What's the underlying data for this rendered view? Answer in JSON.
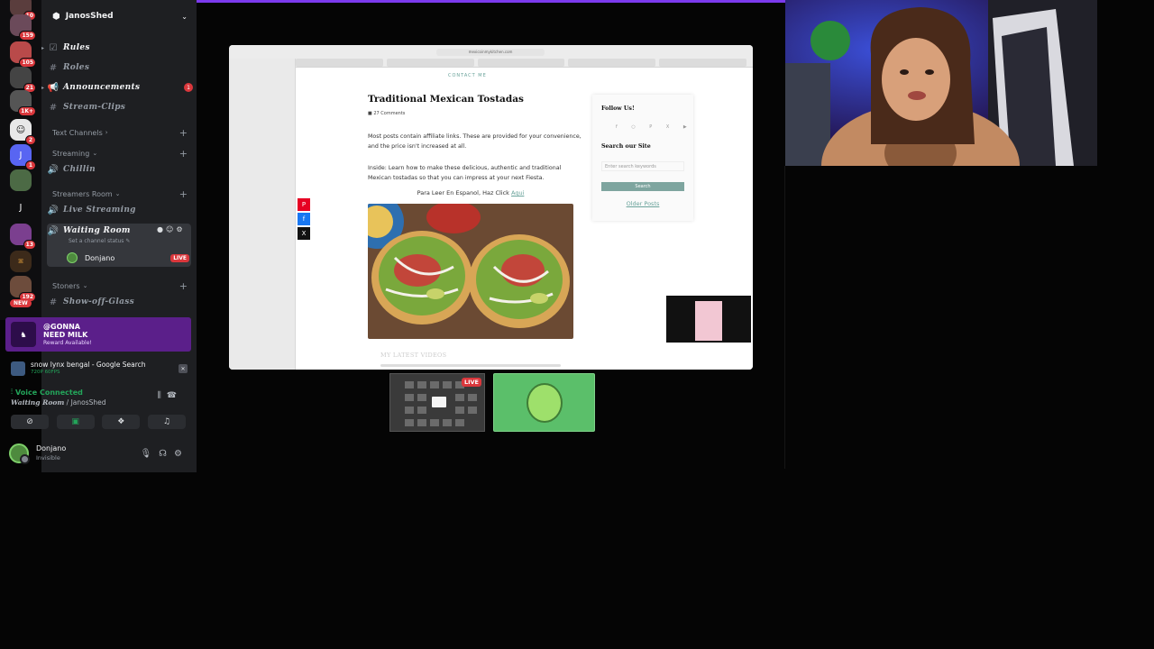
{
  "server_rail": {
    "badges": [
      "10",
      "159",
      "105",
      "21",
      "1K+",
      "2",
      "1",
      "",
      "",
      "13",
      "",
      "192"
    ],
    "letter_icon": "J",
    "new_label": "NEW"
  },
  "server": {
    "name": "JanosShed"
  },
  "channels": [
    {
      "name": "Rules",
      "icon": "rules-icon"
    },
    {
      "name": "Roles",
      "icon": "hash-icon"
    },
    {
      "name": "Announcements",
      "icon": "megaphone-icon",
      "count": "1"
    },
    {
      "name": "Stream-Clips",
      "icon": "hash-icon"
    }
  ],
  "categories": {
    "text": "Text Channels",
    "streaming": "Streaming",
    "streamers": "Streamers Room",
    "stoners": "Stoners"
  },
  "voice_channels": {
    "chillin": "Chillin",
    "live_streaming": "Live Streaming",
    "waiting_room": "Waiting Room",
    "waiting_status": "Set a channel status",
    "show_off": "Show-off-Glass"
  },
  "member": {
    "name": "Donjano",
    "live": "LIVE"
  },
  "reward": {
    "title_line1": "@GONNA",
    "title_line2": "NEED MILK",
    "subtitle": "Reward Available!"
  },
  "activity": {
    "title": "snow lynx bengal - Google Search",
    "sub": "720P 60FPS"
  },
  "voice": {
    "status": "Voice Connected",
    "channel": "Waiting Room",
    "server": "JanosShed"
  },
  "user": {
    "name": "Donjano",
    "status": "Invisible"
  },
  "page": {
    "contact": "CONTACT ME",
    "title": "Traditional Mexican Tostadas",
    "comments": "27 Comments",
    "p1": "Most posts contain affiliate links. These are provided for your convenience, and the price isn't increased at all.",
    "p2": "Inside: Learn how to make these delicious, authentic and traditional Mexican tostadas so that you can impress at your next Fiesta.",
    "espanol": "Para Leer En Espanol, Haz Click",
    "espanol_link": "Aqui",
    "latest": "MY LATEST VIDEOS",
    "follow": "Follow Us!",
    "search_site": "Search our Site",
    "search_placeholder": "Enter search keywords",
    "search_btn": "Search",
    "older": "Older Posts"
  },
  "thumbs": {
    "live": "LIVE"
  },
  "colors": {
    "accent_purple": "#7c3aed",
    "discord_red": "#da373c",
    "discord_green": "#23a55a",
    "site_teal": "#6aa39b"
  }
}
